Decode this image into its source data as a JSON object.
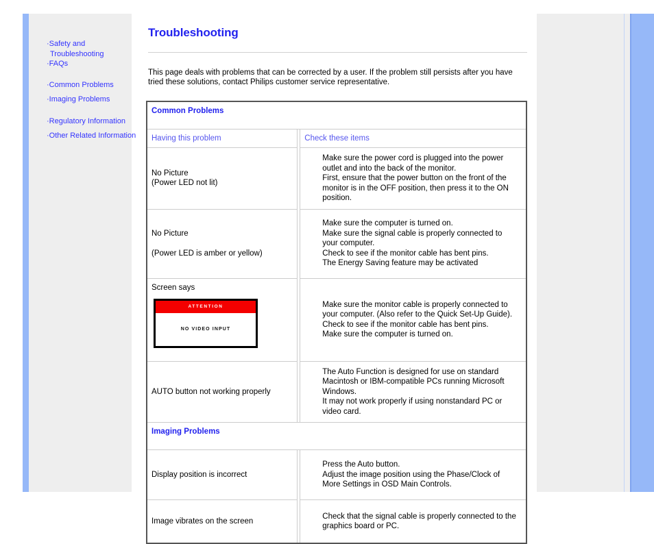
{
  "colors": {
    "link_blue": "#3333ff",
    "title_blue": "#2222ee",
    "accent_strip": "#96b8f8",
    "panel_grey": "#eeeeee",
    "alert_red": "#f40000"
  },
  "sidebar": {
    "groups": [
      {
        "items": [
          {
            "label": "Safety and",
            "continuation": "Troubleshooting"
          },
          {
            "label": "FAQs"
          }
        ]
      },
      {
        "items": [
          {
            "label": "Common Problems"
          },
          {
            "label": "Imaging Problems"
          }
        ]
      },
      {
        "items": [
          {
            "label": "Regulatory Information"
          },
          {
            "label": "Other Related Information"
          }
        ]
      }
    ]
  },
  "main": {
    "title": "Troubleshooting",
    "intro": "This page deals with problems that can be corrected by a user. If the problem still persists after you have tried these solutions, contact Philips customer service representative."
  },
  "tables": {
    "common": {
      "section_title": "Common Problems",
      "col_headers": [
        "Having this problem",
        "Check these items"
      ],
      "rows": [
        {
          "problem": "No Picture\n(Power LED not lit)",
          "checks": "Make sure the power cord is plugged into the power outlet and into the back of the monitor.\nFirst, ensure that the power button on the front of the monitor is in the OFF position, then press it to the ON position."
        },
        {
          "problem": "No Picture\n\n(Power LED is amber or yellow)",
          "checks": "Make sure the computer is turned on.\nMake sure the signal cable is properly connected to your computer.\nCheck to see if the monitor cable has bent pins.\nThe Energy Saving feature may be activated"
        },
        {
          "problem": "Screen says",
          "graphic": {
            "type": "monitor-warning",
            "banner": "ATTENTION",
            "message": "NO VIDEO INPUT"
          },
          "checks": "Make sure the monitor cable is properly connected to your computer. (Also refer to the Quick Set-Up Guide).\nCheck to see if the monitor cable has bent pins.\nMake sure the computer is turned on."
        },
        {
          "problem": "AUTO button not working properly",
          "checks": "The Auto Function is designed for use on standard Macintosh or IBM-compatible PCs running Microsoft Windows.\nIt may not work properly if using nonstandard PC or video card."
        }
      ]
    },
    "imaging": {
      "section_title": "Imaging Problems",
      "rows": [
        {
          "problem": "Display position is incorrect",
          "checks": "Press the Auto button.\nAdjust the image position using the Phase/Clock of More Settings in OSD Main Controls."
        },
        {
          "problem": "Image vibrates on the screen",
          "checks": "Check that the signal cable is properly connected to the graphics board or PC."
        }
      ]
    }
  }
}
